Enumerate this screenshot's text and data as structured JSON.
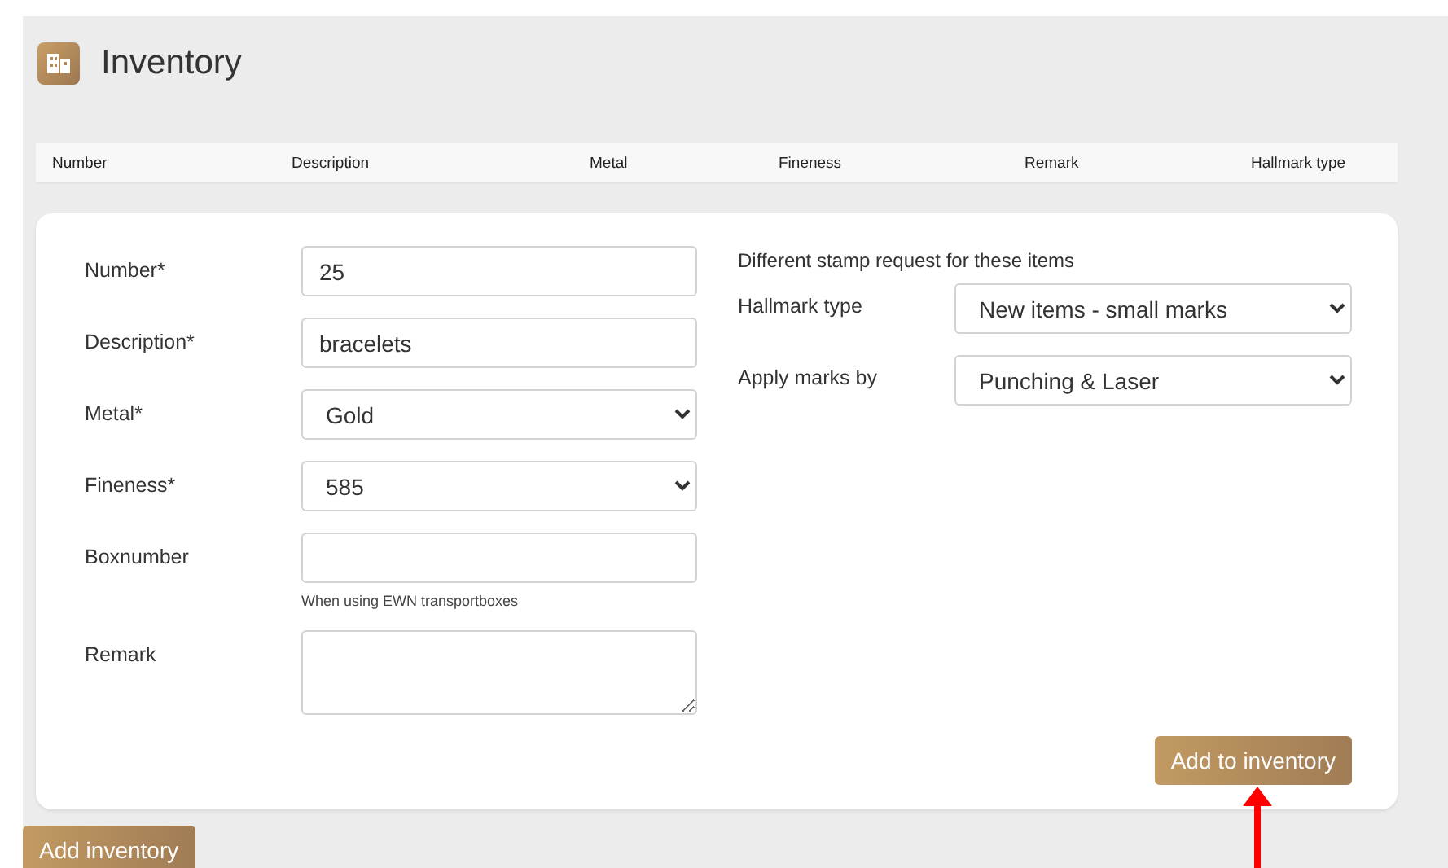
{
  "page": {
    "title": "Inventory"
  },
  "table": {
    "columns": [
      "Number",
      "Description",
      "Metal",
      "Fineness",
      "Remark",
      "Hallmark type"
    ]
  },
  "form": {
    "fields": [
      {
        "kind": "text",
        "label": "Number*",
        "value": "25"
      },
      {
        "kind": "text",
        "label": "Description*",
        "value": "bracelets"
      },
      {
        "kind": "select",
        "label": "Metal*",
        "value": "Gold"
      },
      {
        "kind": "select",
        "label": "Fineness*",
        "value": "585"
      },
      {
        "kind": "text",
        "label": "Boxnumber",
        "hint": "When using EWN transportboxes"
      },
      {
        "kind": "textarea",
        "label": "Remark"
      }
    ],
    "stamp_heading": "Different stamp request for these items",
    "stamp_fields": [
      {
        "kind": "select",
        "label": "Hallmark type",
        "value": "New items - small marks"
      },
      {
        "kind": "select",
        "label": "Apply marks by",
        "value": "Punching & Laser"
      }
    ],
    "submit": "Add to inventory"
  },
  "add_button": "Add inventory"
}
